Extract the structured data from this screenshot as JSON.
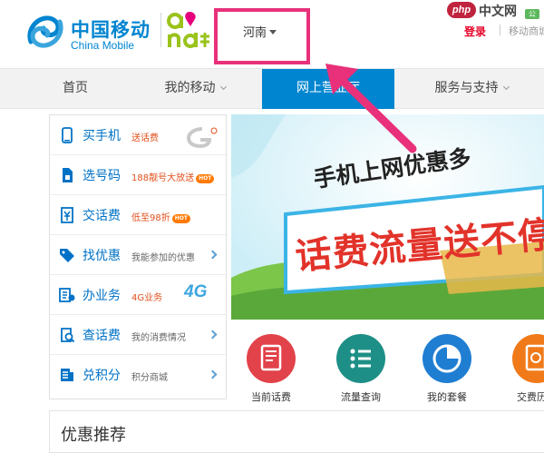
{
  "header": {
    "brand_cn": "中国移动",
    "brand_en": "China Mobile",
    "region": "河南",
    "login": "登录",
    "mobile_link": "移动商城",
    "watermark_site": "中文网",
    "watermark_php": "php",
    "watermark_tag": "公"
  },
  "nav": {
    "home": "首页",
    "my_mobile": "我的移动",
    "hall": "网上营业厅",
    "service": "服务与支持"
  },
  "sidebar": {
    "items": [
      {
        "label": "买手机",
        "promo": "送话费",
        "icon": "phone-icon"
      },
      {
        "label": "选号码",
        "promo": "188靓号大放送",
        "hot": "HOT",
        "icon": "sim-icon"
      },
      {
        "label": "交话费",
        "promo": "低至98折",
        "hot": "HOT",
        "icon": "bill-icon"
      },
      {
        "label": "找优惠",
        "promo": "我能参加的优惠",
        "icon": "tag-icon"
      },
      {
        "label": "办业务",
        "promo": "4G业务",
        "badge": "4G",
        "icon": "service-icon"
      },
      {
        "label": "查话费",
        "promo": "我的消费情况",
        "icon": "query-icon"
      },
      {
        "label": "兑积分",
        "promo": "积分商城",
        "icon": "points-icon"
      }
    ]
  },
  "banner": {
    "headline": "手机上网优惠多",
    "slogan": "话费流量送不停"
  },
  "quick": [
    {
      "label": "当前话费",
      "color": "#e2424a",
      "icon": "document-icon"
    },
    {
      "label": "流量查询",
      "color": "#1e8f86",
      "icon": "list-icon"
    },
    {
      "label": "我的套餐",
      "color": "#1f7ed2",
      "icon": "pie-chart-icon"
    },
    {
      "label": "交费历史",
      "color": "#f07a1a",
      "icon": "history-icon"
    }
  ],
  "recommend": {
    "title": "优惠推荐"
  },
  "colors": {
    "brand_blue": "#0085d0",
    "annotation_pink": "#e8317a",
    "promo_orange": "#e2501c"
  }
}
